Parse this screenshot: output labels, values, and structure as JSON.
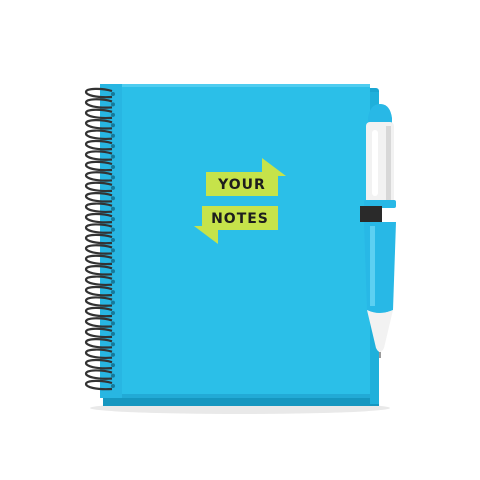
{
  "product": {
    "banner_top": "YOUR",
    "banner_bottom": "NOTES"
  },
  "colors": {
    "cover": "#2bbfe8",
    "cover_edge": "#1aa6d2",
    "page_block": "#47c6ec",
    "banner": "#c6e34a",
    "banner_fold": "#8bb52f",
    "wire": "#333333",
    "pen_white": "#f2f2f2",
    "pen_blue": "#28b8e6",
    "band": "#2a2a2a"
  }
}
